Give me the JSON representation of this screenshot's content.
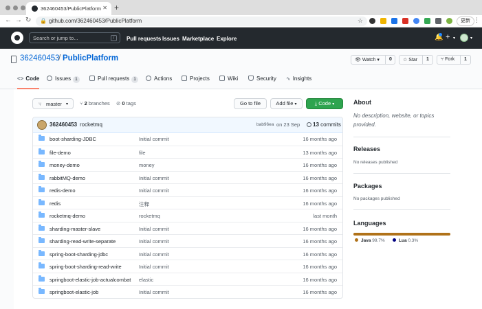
{
  "browser": {
    "tab_title": "362460453/PublicPlatform",
    "url": "github.com/362460453/PublicPlatform",
    "update_label": "更新"
  },
  "github_header": {
    "search_placeholder": "Search or jump to...",
    "search_shortcut": "/",
    "nav": [
      "Pull requests",
      "Issues",
      "Marketplace",
      "Explore"
    ]
  },
  "repo": {
    "owner": "362460453",
    "separator": "/",
    "name": "PublicPlatform",
    "watch": {
      "label": "Watch",
      "count": "0"
    },
    "star": {
      "label": "Star",
      "count": "1"
    },
    "fork": {
      "label": "Fork",
      "count": "1"
    }
  },
  "repo_nav": [
    {
      "label": "Code",
      "counter": "",
      "icon": "code-icon",
      "active": true
    },
    {
      "label": "Issues",
      "counter": "1",
      "icon": "issue-icon",
      "active": false
    },
    {
      "label": "Pull requests",
      "counter": "1",
      "icon": "pull-request-icon",
      "active": false
    },
    {
      "label": "Actions",
      "counter": "",
      "icon": "play-icon",
      "active": false
    },
    {
      "label": "Projects",
      "counter": "",
      "icon": "project-icon",
      "active": false
    },
    {
      "label": "Wiki",
      "counter": "",
      "icon": "book-icon",
      "active": false
    },
    {
      "label": "Security",
      "counter": "",
      "icon": "shield-icon",
      "active": false
    },
    {
      "label": "Insights",
      "counter": "",
      "icon": "graph-icon",
      "active": false
    }
  ],
  "toolbar": {
    "branch": "master",
    "branches_count": "2",
    "branches_label": "branches",
    "tags_count": "0",
    "tags_label": "tags",
    "go_to_file": "Go to file",
    "add_file": "Add file",
    "code": "Code"
  },
  "latest_commit": {
    "author": "362460453",
    "message": "rocketmq",
    "sha": "bab96ea",
    "date": "on 23 Sep",
    "count": "13",
    "count_label": "commits"
  },
  "files": [
    {
      "name": "boot-sharding-JDBC",
      "message": "Initial commit",
      "age": "16 months ago"
    },
    {
      "name": "file-demo",
      "message": "file",
      "age": "13 months ago"
    },
    {
      "name": "money-demo",
      "message": "money",
      "age": "16 months ago"
    },
    {
      "name": "rabbitMQ-demo",
      "message": "Initial commit",
      "age": "16 months ago"
    },
    {
      "name": "redis-demo",
      "message": "Initial commit",
      "age": "16 months ago"
    },
    {
      "name": "redis",
      "message": "注释",
      "age": "16 months ago"
    },
    {
      "name": "rocketmq-demo",
      "message": "rocketmq",
      "age": "last month"
    },
    {
      "name": "sharding-master-slave",
      "message": "Initial commit",
      "age": "16 months ago"
    },
    {
      "name": "sharding-read-write-separate",
      "message": "Initial commit",
      "age": "16 months ago"
    },
    {
      "name": "spring-boot-sharding-jdbc",
      "message": "Initial commit",
      "age": "16 months ago"
    },
    {
      "name": "spring-boot-sharding-read-write",
      "message": "Initial commit",
      "age": "16 months ago"
    },
    {
      "name": "springboot-elastic-job-actualcombat",
      "message": "elastic",
      "age": "16 months ago"
    },
    {
      "name": "springboot-elastic-job",
      "message": "Initial commit",
      "age": "16 months ago"
    }
  ],
  "sidebar": {
    "about_title": "About",
    "about_text": "No description, website, or topics provided.",
    "releases_title": "Releases",
    "releases_text": "No releases published",
    "packages_title": "Packages",
    "packages_text": "No packages published",
    "languages_title": "Languages",
    "languages": [
      {
        "name": "Java",
        "percent": "99.7%",
        "share": 0.997,
        "color": "#b07219"
      },
      {
        "name": "Lua",
        "percent": "0.3%",
        "share": 0.003,
        "color": "#000080"
      }
    ]
  },
  "colors": {
    "header_bg": "#24292e",
    "link": "#0366d6",
    "green_button": "#2ea44f",
    "active_tab_underline": "#f9826c",
    "folder": "#79b8ff"
  }
}
